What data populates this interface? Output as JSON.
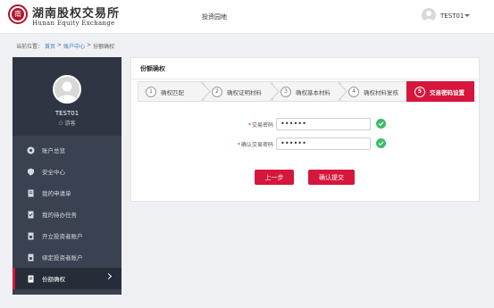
{
  "header": {
    "logo_cn": "湖南股权交易所",
    "logo_en": "Hunan Equity Exchange",
    "logo_seal_char": "南",
    "nav_link": "投资园地",
    "user_name": "TEST01"
  },
  "breadcrumb": {
    "prefix": "当前位置：",
    "items": [
      "首页",
      "账户中心",
      "份额确权"
    ],
    "separator": ">"
  },
  "sidebar": {
    "user_name": "TEST01",
    "role": "游客",
    "items": [
      {
        "label": "账户总览",
        "icon": "dashboard-icon"
      },
      {
        "label": "安全中心",
        "icon": "shield-icon"
      },
      {
        "label": "我的申请单",
        "icon": "document-icon"
      },
      {
        "label": "我的待办任务",
        "icon": "task-icon"
      },
      {
        "label": "开立投资者账户",
        "icon": "account-add-icon"
      },
      {
        "label": "绑定投资者账户",
        "icon": "account-link-icon"
      },
      {
        "label": "份额确权",
        "icon": "share-confirm-icon",
        "active": true
      }
    ]
  },
  "panel": {
    "title": "份额确权",
    "steps": [
      {
        "num": "1",
        "label": "确权匹配"
      },
      {
        "num": "2",
        "label": "确权证明材料"
      },
      {
        "num": "3",
        "label": "确权基本材料"
      },
      {
        "num": "4",
        "label": "确权材料复核"
      },
      {
        "num": "5",
        "label": "交易密码设置",
        "active": true
      }
    ],
    "fields": [
      {
        "label": "交易密码",
        "value": "••••••"
      },
      {
        "label": "确认交易密码",
        "value": "••••••"
      }
    ],
    "buttons": {
      "prev": "上一步",
      "submit": "确认提交"
    }
  },
  "colors": {
    "accent": "#d6163d",
    "sidebar_bg": "#3a4150",
    "success": "#3dbb6a"
  }
}
